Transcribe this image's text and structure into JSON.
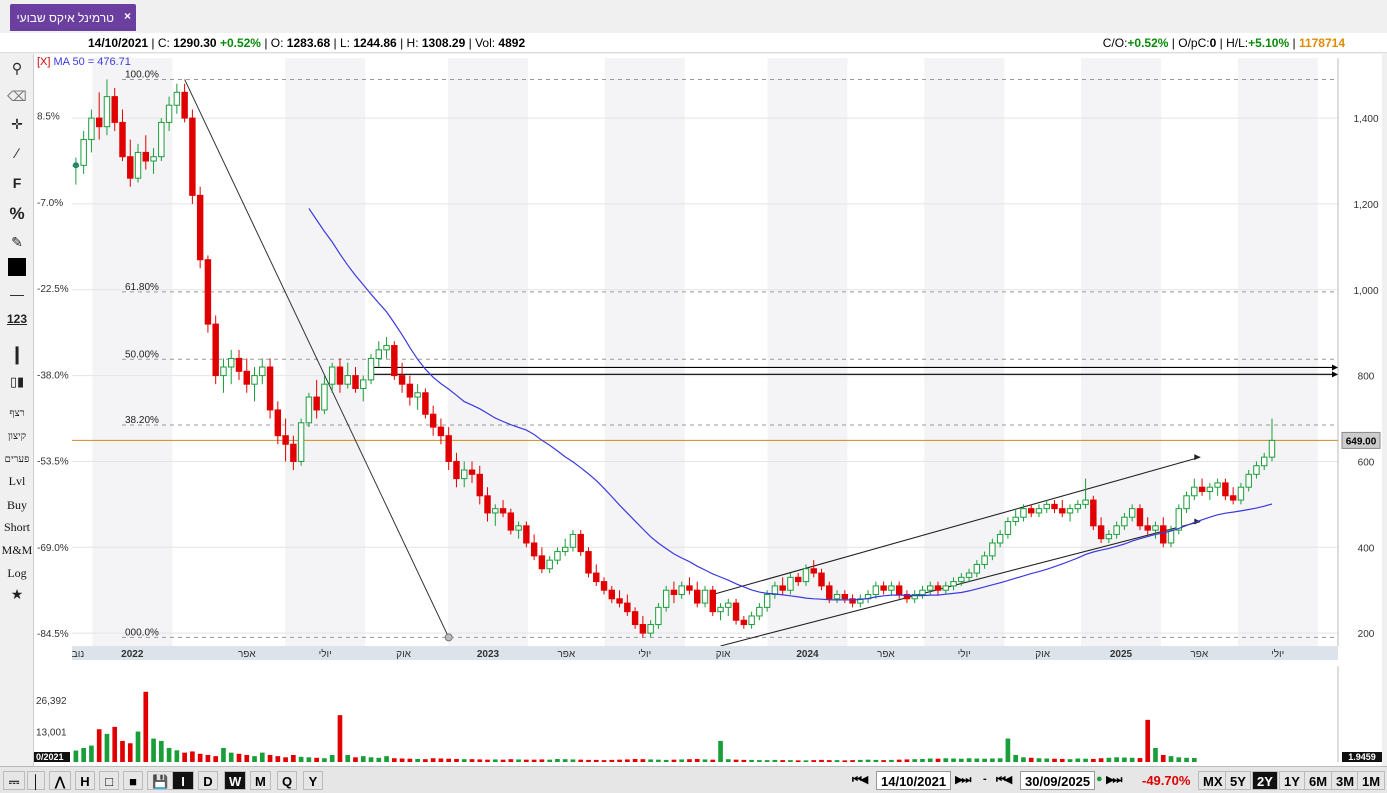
{
  "tab": {
    "label": "טרמינל איקס שבועי",
    "close": "×"
  },
  "infobar": {
    "date": "14/10/2021",
    "close_label": "C:",
    "close": "1290.30",
    "change": "+0.52%",
    "open_label": "O:",
    "open": "1283.68",
    "low_label": "L:",
    "low": "1244.86",
    "high_label": "H:",
    "high": "1308.29",
    "vol_label": "Vol:",
    "vol": "4892",
    "co_label": "C/O:",
    "co": "+0.52%",
    "opc_label": "O/pC:",
    "opc": "0",
    "hl_label": "H/L:",
    "hl": "+5.10%",
    "total_volume": "1178714"
  },
  "indicator": {
    "close_mark": "[X]",
    "label": "MA 50 = 476.71",
    "color": "#3a3ae0"
  },
  "tools": {
    "font_label": "F",
    "percent_label": "%",
    "number_label": "123",
    "text_items": [
      "רצף",
      "קיצון",
      "פערים",
      "Lvl",
      "Buy",
      "Short",
      "M&M",
      "Log"
    ]
  },
  "chart_data": {
    "type": "candlestick",
    "timeframe": "weekly",
    "y_axis": {
      "ticks": [
        200,
        400,
        600,
        800,
        1000,
        1200,
        1400
      ],
      "tick_labels": [
        "200",
        "400",
        "600",
        "800",
        "1,000",
        "1,200",
        "1,400"
      ],
      "range": [
        170,
        1540
      ]
    },
    "percent_axis": {
      "labels": [
        "8.5%",
        "-7.0%",
        "-22.5%",
        "-38.0%",
        "-53.5%",
        "-69.0%",
        "-84.5%"
      ],
      "values": [
        1406,
        1204,
        1004,
        803,
        602,
        401,
        200
      ]
    },
    "fib_levels": [
      {
        "label": "100.0%",
        "value": 1490
      },
      {
        "label": "61.80%",
        "value": 995
      },
      {
        "label": "50.00%",
        "value": 838
      },
      {
        "label": "38.20%",
        "value": 685
      },
      {
        "label": "000.0%",
        "value": 190
      }
    ],
    "last_price": {
      "label": "649.00",
      "value": 649,
      "color": "#d08a1a"
    },
    "x_axis": {
      "labels": [
        "נוב",
        "2022",
        "אפר",
        "יולי",
        "אוק",
        "2023",
        "אפר",
        "יולי",
        "אוק",
        "2024",
        "אפר",
        "יולי",
        "אוק",
        "2025",
        "אפר",
        "יולי"
      ],
      "positions": [
        1,
        10,
        29,
        42,
        55,
        69,
        82,
        95,
        108,
        122,
        135,
        148,
        161,
        174,
        187,
        200
      ],
      "year_index": [
        1,
        5,
        9,
        13
      ]
    },
    "candles": [
      [
        1290,
        1308,
        1245,
        1290
      ],
      [
        1290,
        1370,
        1270,
        1350
      ],
      [
        1350,
        1420,
        1320,
        1400
      ],
      [
        1400,
        1460,
        1350,
        1380
      ],
      [
        1380,
        1490,
        1360,
        1450
      ],
      [
        1450,
        1470,
        1370,
        1390
      ],
      [
        1390,
        1420,
        1300,
        1310
      ],
      [
        1310,
        1350,
        1240,
        1260
      ],
      [
        1260,
        1340,
        1250,
        1320
      ],
      [
        1320,
        1360,
        1280,
        1300
      ],
      [
        1300,
        1330,
        1270,
        1310
      ],
      [
        1310,
        1400,
        1300,
        1390
      ],
      [
        1390,
        1450,
        1370,
        1430
      ],
      [
        1430,
        1480,
        1410,
        1460
      ],
      [
        1460,
        1480,
        1390,
        1400
      ],
      [
        1400,
        1420,
        1200,
        1220
      ],
      [
        1220,
        1240,
        1050,
        1070
      ],
      [
        1070,
        1080,
        900,
        920
      ],
      [
        920,
        940,
        780,
        800
      ],
      [
        800,
        840,
        760,
        820
      ],
      [
        820,
        860,
        780,
        840
      ],
      [
        840,
        860,
        790,
        810
      ],
      [
        810,
        840,
        760,
        780
      ],
      [
        780,
        820,
        740,
        800
      ],
      [
        800,
        840,
        780,
        820
      ],
      [
        820,
        840,
        700,
        720
      ],
      [
        720,
        740,
        640,
        660
      ],
      [
        660,
        700,
        600,
        640
      ],
      [
        640,
        660,
        580,
        600
      ],
      [
        600,
        700,
        590,
        690
      ],
      [
        690,
        760,
        680,
        750
      ],
      [
        750,
        790,
        700,
        720
      ],
      [
        720,
        800,
        710,
        780
      ],
      [
        780,
        830,
        760,
        820
      ],
      [
        820,
        840,
        760,
        780
      ],
      [
        780,
        830,
        770,
        800
      ],
      [
        800,
        820,
        760,
        770
      ],
      [
        770,
        800,
        740,
        790
      ],
      [
        790,
        850,
        780,
        840
      ],
      [
        840,
        880,
        820,
        860
      ],
      [
        860,
        890,
        840,
        870
      ],
      [
        870,
        880,
        790,
        800
      ],
      [
        800,
        830,
        760,
        780
      ],
      [
        780,
        800,
        730,
        750
      ],
      [
        750,
        780,
        720,
        760
      ],
      [
        760,
        770,
        700,
        710
      ],
      [
        710,
        730,
        660,
        680
      ],
      [
        680,
        700,
        640,
        660
      ],
      [
        660,
        680,
        580,
        600
      ],
      [
        600,
        620,
        540,
        560
      ],
      [
        560,
        600,
        540,
        580
      ],
      [
        580,
        600,
        550,
        570
      ],
      [
        570,
        590,
        500,
        520
      ],
      [
        520,
        540,
        460,
        480
      ],
      [
        480,
        500,
        450,
        490
      ],
      [
        490,
        510,
        470,
        480
      ],
      [
        480,
        490,
        430,
        440
      ],
      [
        440,
        460,
        420,
        450
      ],
      [
        450,
        460,
        400,
        410
      ],
      [
        410,
        430,
        370,
        380
      ],
      [
        380,
        400,
        340,
        350
      ],
      [
        350,
        380,
        340,
        370
      ],
      [
        370,
        400,
        360,
        390
      ],
      [
        390,
        420,
        380,
        400
      ],
      [
        400,
        440,
        390,
        430
      ],
      [
        430,
        440,
        380,
        390
      ],
      [
        390,
        400,
        330,
        340
      ],
      [
        340,
        360,
        310,
        320
      ],
      [
        320,
        330,
        290,
        300
      ],
      [
        300,
        310,
        270,
        280
      ],
      [
        280,
        300,
        260,
        270
      ],
      [
        270,
        290,
        240,
        250
      ],
      [
        250,
        260,
        210,
        220
      ],
      [
        220,
        240,
        190,
        200
      ],
      [
        200,
        230,
        190,
        220
      ],
      [
        220,
        270,
        210,
        260
      ],
      [
        260,
        310,
        250,
        300
      ],
      [
        300,
        320,
        270,
        290
      ],
      [
        290,
        320,
        280,
        310
      ],
      [
        310,
        330,
        290,
        300
      ],
      [
        300,
        320,
        260,
        270
      ],
      [
        270,
        310,
        260,
        300
      ],
      [
        300,
        310,
        240,
        250
      ],
      [
        250,
        270,
        230,
        260
      ],
      [
        260,
        280,
        240,
        270
      ],
      [
        270,
        280,
        220,
        230
      ],
      [
        230,
        240,
        210,
        220
      ],
      [
        220,
        250,
        210,
        240
      ],
      [
        240,
        270,
        230,
        260
      ],
      [
        260,
        300,
        250,
        290
      ],
      [
        290,
        320,
        280,
        310
      ],
      [
        310,
        330,
        290,
        300
      ],
      [
        300,
        340,
        290,
        330
      ],
      [
        330,
        340,
        310,
        320
      ],
      [
        320,
        360,
        310,
        350
      ],
      [
        350,
        370,
        330,
        340
      ],
      [
        340,
        350,
        300,
        310
      ],
      [
        310,
        320,
        270,
        280
      ],
      [
        280,
        300,
        270,
        290
      ],
      [
        290,
        300,
        270,
        280
      ],
      [
        280,
        290,
        260,
        270
      ],
      [
        270,
        290,
        260,
        280
      ],
      [
        280,
        300,
        270,
        290
      ],
      [
        290,
        320,
        280,
        310
      ],
      [
        310,
        320,
        290,
        300
      ],
      [
        300,
        320,
        290,
        310
      ],
      [
        310,
        320,
        280,
        290
      ],
      [
        290,
        300,
        270,
        280
      ],
      [
        280,
        300,
        270,
        290
      ],
      [
        290,
        310,
        280,
        300
      ],
      [
        300,
        320,
        290,
        310
      ],
      [
        310,
        320,
        290,
        300
      ],
      [
        300,
        320,
        290,
        310
      ],
      [
        310,
        330,
        300,
        320
      ],
      [
        320,
        340,
        310,
        330
      ],
      [
        330,
        350,
        320,
        340
      ],
      [
        340,
        370,
        330,
        360
      ],
      [
        360,
        390,
        350,
        380
      ],
      [
        380,
        420,
        370,
        410
      ],
      [
        410,
        440,
        400,
        430
      ],
      [
        430,
        470,
        420,
        460
      ],
      [
        460,
        490,
        450,
        470
      ],
      [
        470,
        500,
        460,
        490
      ],
      [
        490,
        500,
        470,
        480
      ],
      [
        480,
        500,
        470,
        490
      ],
      [
        490,
        510,
        480,
        500
      ],
      [
        500,
        510,
        480,
        490
      ],
      [
        490,
        510,
        470,
        480
      ],
      [
        480,
        500,
        460,
        490
      ],
      [
        490,
        510,
        480,
        500
      ],
      [
        500,
        560,
        490,
        510
      ],
      [
        510,
        520,
        440,
        450
      ],
      [
        450,
        470,
        410,
        420
      ],
      [
        420,
        440,
        410,
        430
      ],
      [
        430,
        460,
        420,
        450
      ],
      [
        450,
        480,
        440,
        470
      ],
      [
        470,
        500,
        460,
        490
      ],
      [
        490,
        500,
        440,
        450
      ],
      [
        450,
        470,
        430,
        440
      ],
      [
        440,
        460,
        420,
        450
      ],
      [
        450,
        470,
        400,
        410
      ],
      [
        410,
        450,
        400,
        440
      ],
      [
        440,
        500,
        430,
        490
      ],
      [
        490,
        530,
        480,
        520
      ],
      [
        520,
        560,
        510,
        540
      ],
      [
        540,
        560,
        520,
        530
      ],
      [
        530,
        550,
        510,
        540
      ],
      [
        540,
        560,
        520,
        550
      ],
      [
        550,
        560,
        510,
        520
      ],
      [
        520,
        540,
        500,
        510
      ],
      [
        510,
        550,
        500,
        540
      ],
      [
        540,
        580,
        530,
        570
      ],
      [
        570,
        600,
        560,
        590
      ],
      [
        590,
        620,
        580,
        610
      ],
      [
        610,
        700,
        600,
        649
      ]
    ],
    "volumes": [
      4892,
      6000,
      7000,
      14000,
      12000,
      15000,
      9000,
      8000,
      13000,
      30000,
      10000,
      9000,
      6000,
      5000,
      4000,
      4500,
      3500,
      3000,
      2500,
      6000,
      4000,
      3500,
      3000,
      2500,
      4000,
      3000,
      2500,
      2000,
      3000,
      2200,
      2000,
      1800,
      1600,
      3000,
      20000,
      3000,
      2000,
      2500,
      2000,
      1800,
      2500,
      1600,
      1500,
      1400,
      1300,
      1200,
      1600,
      1500,
      1400,
      1300,
      1200,
      1200,
      1100,
      1000,
      1100,
      1000,
      1200,
      1100,
      1000,
      1000,
      1100,
      1000,
      1300,
      1200,
      1100,
      1000,
      900,
      900,
      800,
      900,
      1000,
      1100,
      1300,
      1200,
      1100,
      1000,
      900,
      1000,
      1100,
      1200,
      1300,
      1100,
      1000,
      9000,
      1200,
      1000,
      900,
      900,
      800,
      800,
      900,
      800,
      800,
      700,
      700,
      800,
      900,
      800,
      800,
      700,
      800,
      900,
      1000,
      900,
      800,
      900,
      1000,
      1100,
      1200,
      1300,
      1500,
      1400,
      1600,
      1500,
      1400,
      1600,
      1500,
      1400,
      1500,
      1600,
      10000,
      3000,
      2000,
      1800,
      1600,
      1500,
      1400,
      1300,
      1200,
      1500,
      1400,
      1300,
      1600,
      1800,
      2000,
      1900,
      1800,
      1700,
      18000,
      6000,
      3000,
      2500,
      2000,
      1800,
      1700
    ],
    "volume_axis": {
      "tick_labels": [
        "26,392",
        "13,001"
      ],
      "values": [
        26392,
        13001
      ],
      "max": 41000
    },
    "ma_label": "MA 50",
    "x_first_label": "0/2021",
    "x_last_label": "1.9459"
  },
  "bottombar": {
    "periods": [
      "D",
      "W",
      "M",
      "Q",
      "Y"
    ],
    "selected_period": "W",
    "start_date": "14/10/2021",
    "end_date": "30/09/2025",
    "change": "-49.70%",
    "ranges": [
      "MX",
      "5Y",
      "2Y",
      "1Y",
      "6M",
      "3M",
      "1M"
    ],
    "selected_range": "2Y",
    "chart_types": [
      "I",
      "D",
      "W",
      "M",
      "Q",
      "Y"
    ],
    "separator": "-"
  }
}
